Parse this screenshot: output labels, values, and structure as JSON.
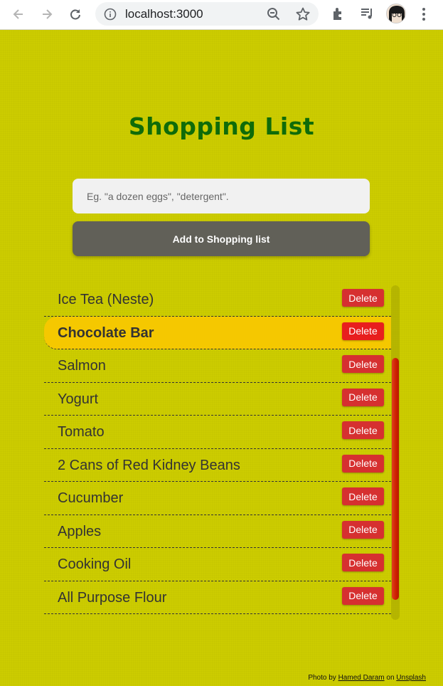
{
  "browser": {
    "url": "localhost:3000"
  },
  "app": {
    "title": "Shopping List",
    "input_placeholder": "Eg. \"a dozen eggs\", \"detergent\".",
    "input_value": "",
    "add_button_label": "Add to Shopping list"
  },
  "items": [
    {
      "label": "Ice Tea (Neste)",
      "delete_label": "Delete"
    },
    {
      "label": "Chocolate Bar",
      "delete_label": "Delete",
      "selected": true
    },
    {
      "label": "Salmon",
      "delete_label": "Delete"
    },
    {
      "label": "Yogurt",
      "delete_label": "Delete"
    },
    {
      "label": "Tomato",
      "delete_label": "Delete"
    },
    {
      "label": "2 Cans of Red Kidney Beans",
      "delete_label": "Delete"
    },
    {
      "label": "Cucumber",
      "delete_label": "Delete"
    },
    {
      "label": "Apples",
      "delete_label": "Delete"
    },
    {
      "label": "Cooking Oil",
      "delete_label": "Delete"
    },
    {
      "label": "All Purpose Flour",
      "delete_label": "Delete"
    }
  ],
  "credit": {
    "prefix": "Photo by",
    "author": "Hamed Daram",
    "middle": "on",
    "site": "Unsplash"
  },
  "colors": {
    "background": "#cccc00",
    "title": "#0f6b09",
    "selected_row": "#f5c800",
    "delete_button": "#d63030",
    "add_button": "#616058"
  }
}
